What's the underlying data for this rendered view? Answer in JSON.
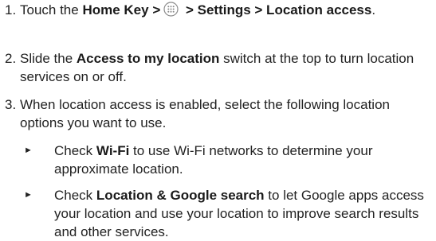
{
  "steps": [
    {
      "number": "1.",
      "t1": "Touch the ",
      "b1": "Home Key >",
      "icon": "apps-grid-icon",
      "b2": " > Settings > Location access",
      "t2": "."
    },
    {
      "number": "2.",
      "t1": "Slide the ",
      "b1": "Access to my location",
      "t2": " switch at the top to turn location services on or off."
    },
    {
      "number": "3.",
      "t1": "When location access is enabled, select the following location options you want to use."
    }
  ],
  "bullets": [
    {
      "marker": "►",
      "t1": "Check ",
      "b1": "Wi-Fi",
      "t2": " to use Wi-Fi networks to determine your approximate location."
    },
    {
      "marker": "►",
      "t1": "Check ",
      "b1": "Location & Google search",
      "t2": " to let Google apps access your location and use your location to improve search results and other services."
    }
  ]
}
